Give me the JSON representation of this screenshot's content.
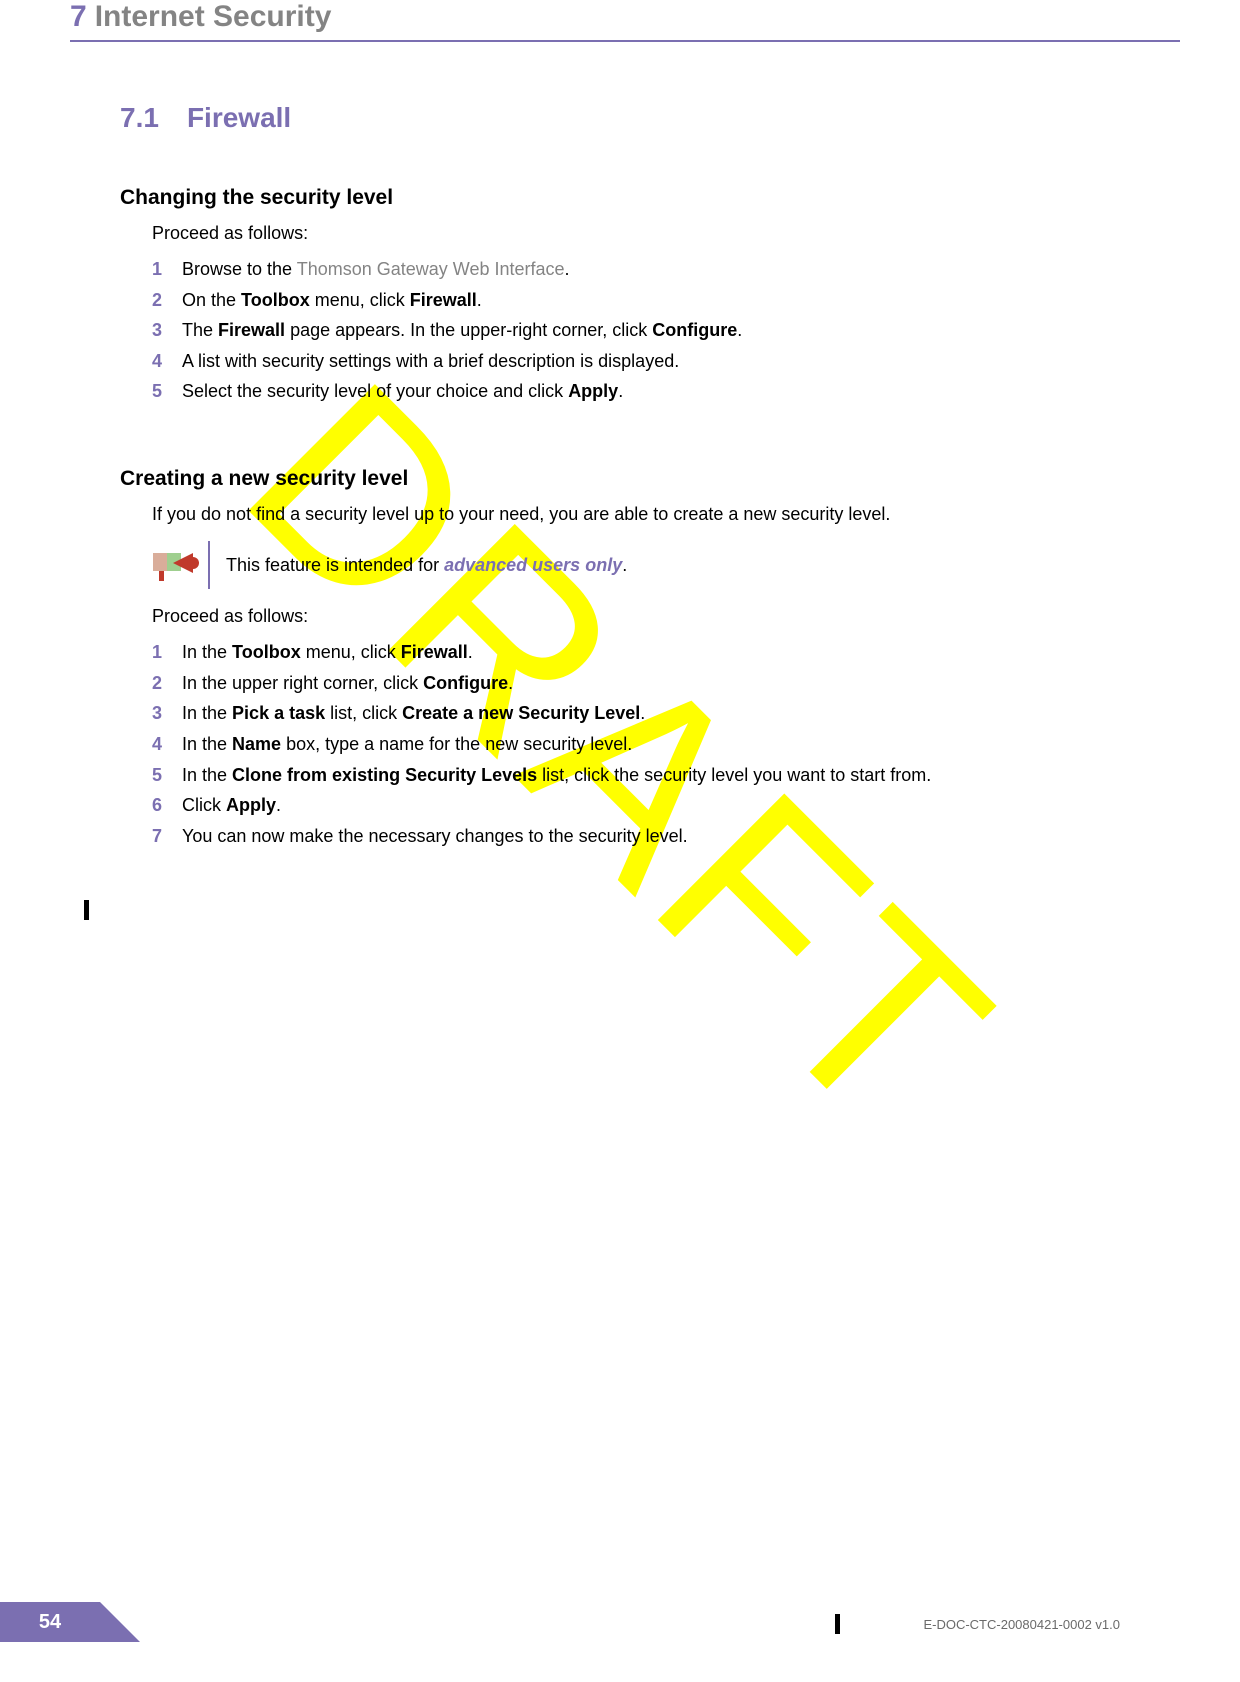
{
  "watermark": "DRAFT",
  "header": {
    "chapter_num": "7",
    "chapter_title": "Internet Security"
  },
  "section": {
    "num": "7.1",
    "title": "Firewall"
  },
  "sub1": {
    "heading": "Changing the security level",
    "intro": "Proceed as follows:",
    "steps": [
      {
        "n": "1",
        "pre": "Browse to the ",
        "link": "Thomson Gateway Web Interface",
        "post": "."
      },
      {
        "n": "2",
        "pre": "On the ",
        "b1": "Toolbox",
        "mid": " menu, click ",
        "b2": "Firewall",
        "post": "."
      },
      {
        "n": "3",
        "pre": "The ",
        "b1": "Firewall",
        "mid": " page appears. In the upper-right corner, click ",
        "b2": "Configure",
        "post": "."
      },
      {
        "n": "4",
        "plain": "A list with security settings with a brief description is displayed."
      },
      {
        "n": "5",
        "pre": "Select the security level of your choice and click ",
        "b1": "Apply",
        "post": "."
      }
    ]
  },
  "sub2": {
    "heading": "Creating a new security level",
    "intro1": "If you do not find a security level up to your need, you are able to create a new security level.",
    "note_pre": "This feature is intended for ",
    "note_em": "advanced users only",
    "note_post": ".",
    "intro2": "Proceed as follows:",
    "steps": [
      {
        "n": "1",
        "pre": "In the ",
        "b1": "Toolbox",
        "mid": " menu, click ",
        "b2": "Firewall",
        "post": "."
      },
      {
        "n": "2",
        "pre": "In the upper right corner, click ",
        "b1": "Configure",
        "post": "."
      },
      {
        "n": "3",
        "pre": "In the ",
        "b1": "Pick a task",
        "mid": " list, click ",
        "b2": "Create a new Security Level",
        "post": "."
      },
      {
        "n": "4",
        "pre": "In the ",
        "b1": "Name",
        "mid": " box, type a name for the new security level.",
        "post": ""
      },
      {
        "n": "5",
        "pre": "In the ",
        "b1": "Clone from existing Security Levels",
        "mid": " list, click the security level you want to start from.",
        "post": ""
      },
      {
        "n": "6",
        "pre": "Click ",
        "b1": "Apply",
        "post": "."
      },
      {
        "n": "7",
        "plain": "You can now make the necessary changes to the security level."
      }
    ]
  },
  "footer": {
    "page": "54",
    "docid": "E-DOC-CTC-20080421-0002 v1.0"
  }
}
